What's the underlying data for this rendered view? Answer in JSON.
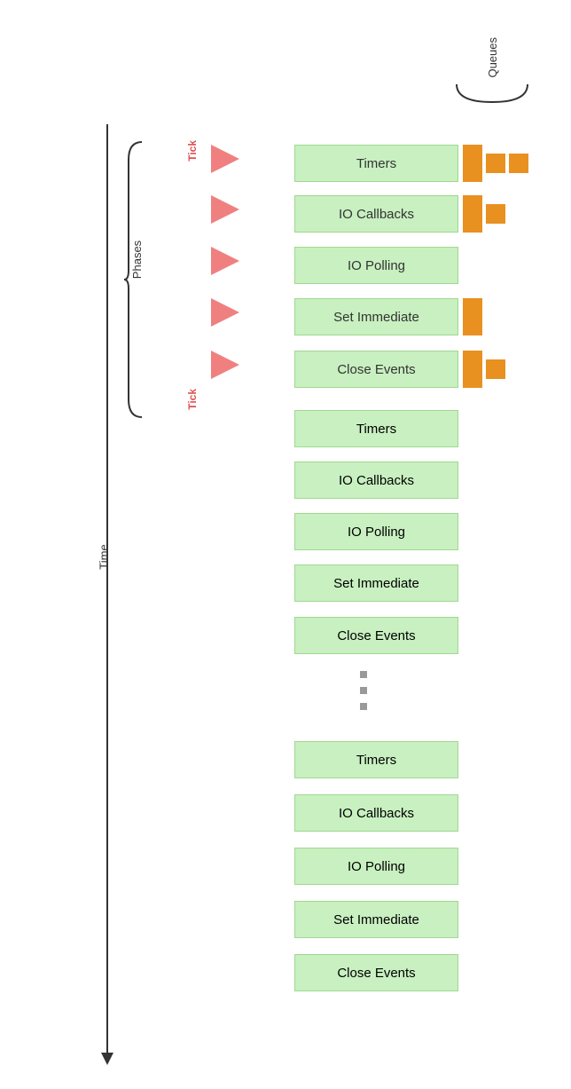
{
  "labels": {
    "time": "Time",
    "phases": "Phases",
    "queues": "Queues",
    "tick": "Tick"
  },
  "cycles": [
    {
      "id": "cycle1",
      "topOffset": 155,
      "showTick": true,
      "tickTop": true,
      "showQueues": true,
      "phases": [
        {
          "name": "Timers",
          "queues": [
            42,
            22,
            22
          ]
        },
        {
          "name": "IO Callbacks",
          "queues": [
            42,
            22
          ]
        },
        {
          "name": "IO Polling",
          "queues": []
        },
        {
          "name": "Set Immediate",
          "queues": [
            42
          ]
        },
        {
          "name": "Close Events",
          "queues": [
            42,
            22
          ]
        }
      ]
    },
    {
      "id": "cycle2",
      "topOffset": 460,
      "showTick": true,
      "tickTop": false,
      "showQueues": false,
      "phases": [
        {
          "name": "Timers",
          "queues": []
        },
        {
          "name": "IO Callbacks",
          "queues": []
        },
        {
          "name": "IO Polling",
          "queues": []
        },
        {
          "name": "Set Immediate",
          "queues": []
        },
        {
          "name": "Close Events",
          "queues": []
        }
      ]
    },
    {
      "id": "cycle3",
      "topOffset": 830,
      "showTick": false,
      "showQueues": false,
      "phases": [
        {
          "name": "Timers",
          "queues": []
        },
        {
          "name": "IO Callbacks",
          "queues": []
        },
        {
          "name": "IO Polling",
          "queues": []
        },
        {
          "name": "Set Immediate",
          "queues": []
        },
        {
          "name": "Close Events",
          "queues": []
        }
      ]
    }
  ],
  "dotsTop": 760,
  "queueBlockHeights": [
    42,
    42,
    42
  ]
}
